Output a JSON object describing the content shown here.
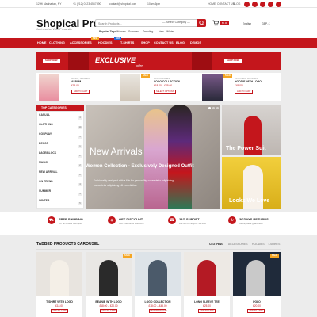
{
  "topbar": {
    "address": "12 Hi Manhattan, NY",
    "phone": "+1 (212) 0123 4567890",
    "email": "contact@shopical.com",
    "hours": "10am-6pm",
    "links": [
      "HOME",
      "CONTACT US",
      "BLOG"
    ],
    "social_icons": [
      "facebook-icon",
      "twitter-icon",
      "instagram-icon",
      "pinterest-icon",
      "youtube-icon"
    ]
  },
  "header": {
    "logo": "Shopical Pro",
    "tagline": "Just another WordPress site",
    "search_placeholder": "Search Products...",
    "category_select": "— Select Category —",
    "popular_tags": [
      "Popular Tags:",
      "Women",
      "Summer",
      "Trending",
      "New",
      "Winter"
    ],
    "cart_total": "$0.00",
    "language": "English",
    "currency": "GBP, £"
  },
  "nav": {
    "items": [
      "HOME",
      "CLOTHING",
      "ACCESSORIES",
      "HOODIES",
      "T-SHIRTS",
      "SHOP",
      "CONTACT US",
      "BLOG",
      "DEMOS"
    ],
    "new_badge": "NEW",
    "hot_badge": "HOT"
  },
  "promo": {
    "title": "EXCLUSIVE",
    "subtitle": "offer",
    "left_button": "SHOP NOW",
    "right_button": "SHOP NOW"
  },
  "product_strip": [
    {
      "category": "MUSIC, SINGLES",
      "title": "ALBUM",
      "price": "£15.00",
      "button": "ADD TO CART"
    },
    {
      "category": "ACCESSORIES",
      "title": "LOGO COLLECTION",
      "price": "£18.00 – £45.00",
      "button": "SELECT OPTIONS",
      "badge": "SALE"
    },
    {
      "category": "CLOTHING, HOODIES",
      "title": "HOODIE WITH LOGO",
      "price": "£45.00",
      "button": "ADD TO CART",
      "badge": "SALE"
    }
  ],
  "categories": {
    "heading": "TOP CATEGORIES",
    "items": [
      {
        "name": "CASUAL",
        "count": "4"
      },
      {
        "name": "CLOTHING",
        "count": "14"
      },
      {
        "name": "COSPLAY",
        "count": "3"
      },
      {
        "name": "DECOR",
        "count": "1"
      },
      {
        "name": "LACE/BLOCK",
        "count": "2"
      },
      {
        "name": "MUSIC",
        "count": "2"
      },
      {
        "name": "NEW ARRIVAL",
        "count": "8"
      },
      {
        "name": "ON TREND",
        "count": "4"
      },
      {
        "name": "SUMMER",
        "count": "4"
      },
      {
        "name": "WINTER",
        "count": "5"
      }
    ]
  },
  "hero": {
    "title": "New Arrivals",
    "subtitle": "Women Collection - Exclusively Designed Outfit",
    "body_line1": "Fashionably designed with a flair for personality, consectetur adipisicing",
    "body_line2": "consectetur adipisicing elit exercitation"
  },
  "side_banners": [
    {
      "text": "The Power Suit"
    },
    {
      "text": "Looks We Love"
    }
  ],
  "features": [
    {
      "icon": "truck-icon",
      "title": "FREE SHIPPING",
      "sub": "On all orders over $99"
    },
    {
      "icon": "gift-icon",
      "title": "GET DISCOUNT",
      "sub": "Get Coupon & Discount"
    },
    {
      "icon": "support-icon",
      "title": "24/7 SUPORT",
      "sub": "We will be at your service"
    },
    {
      "icon": "return-icon",
      "title": "30 DAYS RETURNS",
      "sub": "Moneyback guarantee"
    }
  ],
  "tabbed": {
    "heading": "TABBED PRODUCTS CAROUSEL",
    "tabs": [
      "CLOTHING",
      "ACCESSORIES",
      "HOODIES",
      "T-SHIRTS"
    ],
    "products": [
      {
        "title": "T-SHIRT WITH LOGO",
        "price": "£18.00",
        "button": "ADD TO CART"
      },
      {
        "title": "BEANIE WITH LOGO",
        "price": "£18.00 – £20.00",
        "button": "ADD TO CART",
        "badge": "SALE"
      },
      {
        "title": "LOGO COLLECTION",
        "price": "£18.00 – £45.00",
        "button": "VIEW PRODUCTS"
      },
      {
        "title": "LONG SLEEVE TEE",
        "price": "£25.00",
        "button": "ADD TO CART"
      },
      {
        "title": "POLO",
        "price": "£20.00",
        "button": "ADD TO CART",
        "badge": "SALE"
      }
    ]
  },
  "colors": {
    "accent": "#c4161c",
    "sale": "#f5a623"
  }
}
